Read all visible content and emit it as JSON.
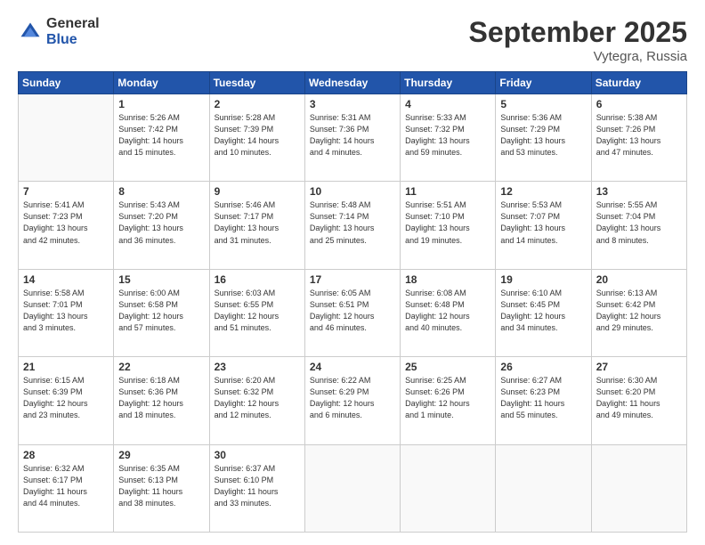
{
  "logo": {
    "general": "General",
    "blue": "Blue"
  },
  "header": {
    "month": "September 2025",
    "location": "Vytegra, Russia"
  },
  "weekdays": [
    "Sunday",
    "Monday",
    "Tuesday",
    "Wednesday",
    "Thursday",
    "Friday",
    "Saturday"
  ],
  "weeks": [
    [
      {
        "day": "",
        "info": ""
      },
      {
        "day": "1",
        "info": "Sunrise: 5:26 AM\nSunset: 7:42 PM\nDaylight: 14 hours\nand 15 minutes."
      },
      {
        "day": "2",
        "info": "Sunrise: 5:28 AM\nSunset: 7:39 PM\nDaylight: 14 hours\nand 10 minutes."
      },
      {
        "day": "3",
        "info": "Sunrise: 5:31 AM\nSunset: 7:36 PM\nDaylight: 14 hours\nand 4 minutes."
      },
      {
        "day": "4",
        "info": "Sunrise: 5:33 AM\nSunset: 7:32 PM\nDaylight: 13 hours\nand 59 minutes."
      },
      {
        "day": "5",
        "info": "Sunrise: 5:36 AM\nSunset: 7:29 PM\nDaylight: 13 hours\nand 53 minutes."
      },
      {
        "day": "6",
        "info": "Sunrise: 5:38 AM\nSunset: 7:26 PM\nDaylight: 13 hours\nand 47 minutes."
      }
    ],
    [
      {
        "day": "7",
        "info": "Sunrise: 5:41 AM\nSunset: 7:23 PM\nDaylight: 13 hours\nand 42 minutes."
      },
      {
        "day": "8",
        "info": "Sunrise: 5:43 AM\nSunset: 7:20 PM\nDaylight: 13 hours\nand 36 minutes."
      },
      {
        "day": "9",
        "info": "Sunrise: 5:46 AM\nSunset: 7:17 PM\nDaylight: 13 hours\nand 31 minutes."
      },
      {
        "day": "10",
        "info": "Sunrise: 5:48 AM\nSunset: 7:14 PM\nDaylight: 13 hours\nand 25 minutes."
      },
      {
        "day": "11",
        "info": "Sunrise: 5:51 AM\nSunset: 7:10 PM\nDaylight: 13 hours\nand 19 minutes."
      },
      {
        "day": "12",
        "info": "Sunrise: 5:53 AM\nSunset: 7:07 PM\nDaylight: 13 hours\nand 14 minutes."
      },
      {
        "day": "13",
        "info": "Sunrise: 5:55 AM\nSunset: 7:04 PM\nDaylight: 13 hours\nand 8 minutes."
      }
    ],
    [
      {
        "day": "14",
        "info": "Sunrise: 5:58 AM\nSunset: 7:01 PM\nDaylight: 13 hours\nand 3 minutes."
      },
      {
        "day": "15",
        "info": "Sunrise: 6:00 AM\nSunset: 6:58 PM\nDaylight: 12 hours\nand 57 minutes."
      },
      {
        "day": "16",
        "info": "Sunrise: 6:03 AM\nSunset: 6:55 PM\nDaylight: 12 hours\nand 51 minutes."
      },
      {
        "day": "17",
        "info": "Sunrise: 6:05 AM\nSunset: 6:51 PM\nDaylight: 12 hours\nand 46 minutes."
      },
      {
        "day": "18",
        "info": "Sunrise: 6:08 AM\nSunset: 6:48 PM\nDaylight: 12 hours\nand 40 minutes."
      },
      {
        "day": "19",
        "info": "Sunrise: 6:10 AM\nSunset: 6:45 PM\nDaylight: 12 hours\nand 34 minutes."
      },
      {
        "day": "20",
        "info": "Sunrise: 6:13 AM\nSunset: 6:42 PM\nDaylight: 12 hours\nand 29 minutes."
      }
    ],
    [
      {
        "day": "21",
        "info": "Sunrise: 6:15 AM\nSunset: 6:39 PM\nDaylight: 12 hours\nand 23 minutes."
      },
      {
        "day": "22",
        "info": "Sunrise: 6:18 AM\nSunset: 6:36 PM\nDaylight: 12 hours\nand 18 minutes."
      },
      {
        "day": "23",
        "info": "Sunrise: 6:20 AM\nSunset: 6:32 PM\nDaylight: 12 hours\nand 12 minutes."
      },
      {
        "day": "24",
        "info": "Sunrise: 6:22 AM\nSunset: 6:29 PM\nDaylight: 12 hours\nand 6 minutes."
      },
      {
        "day": "25",
        "info": "Sunrise: 6:25 AM\nSunset: 6:26 PM\nDaylight: 12 hours\nand 1 minute."
      },
      {
        "day": "26",
        "info": "Sunrise: 6:27 AM\nSunset: 6:23 PM\nDaylight: 11 hours\nand 55 minutes."
      },
      {
        "day": "27",
        "info": "Sunrise: 6:30 AM\nSunset: 6:20 PM\nDaylight: 11 hours\nand 49 minutes."
      }
    ],
    [
      {
        "day": "28",
        "info": "Sunrise: 6:32 AM\nSunset: 6:17 PM\nDaylight: 11 hours\nand 44 minutes."
      },
      {
        "day": "29",
        "info": "Sunrise: 6:35 AM\nSunset: 6:13 PM\nDaylight: 11 hours\nand 38 minutes."
      },
      {
        "day": "30",
        "info": "Sunrise: 6:37 AM\nSunset: 6:10 PM\nDaylight: 11 hours\nand 33 minutes."
      },
      {
        "day": "",
        "info": ""
      },
      {
        "day": "",
        "info": ""
      },
      {
        "day": "",
        "info": ""
      },
      {
        "day": "",
        "info": ""
      }
    ]
  ]
}
